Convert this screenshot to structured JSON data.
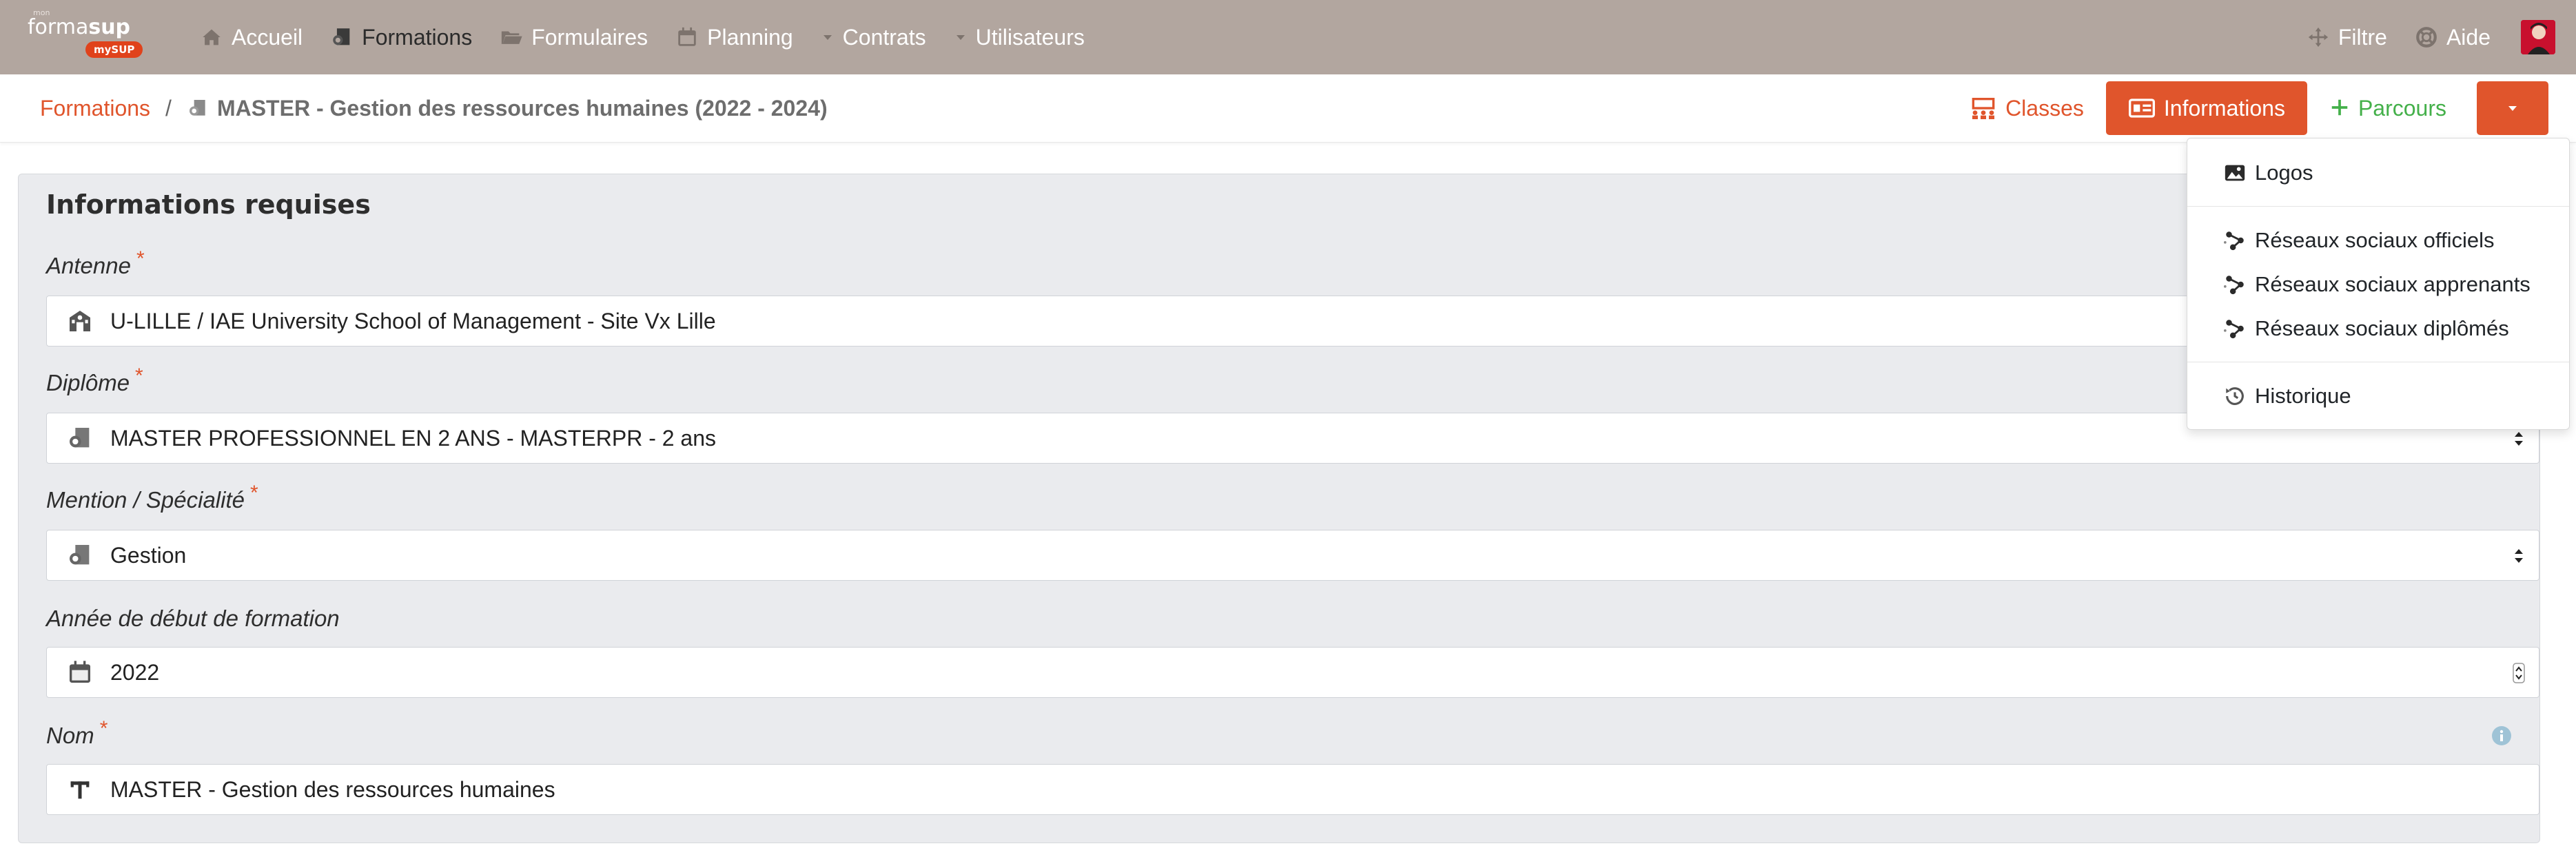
{
  "navbar": {
    "brand_tiny": "mon",
    "brand_name_1": "forma",
    "brand_name_2": "sup",
    "brand_sub": "mySUP",
    "items": [
      {
        "label": "Accueil",
        "icon": "home-icon"
      },
      {
        "label": "Formations",
        "icon": "formations-icon",
        "active": true
      },
      {
        "label": "Formulaires",
        "icon": "folder-open-icon"
      },
      {
        "label": "Planning",
        "icon": "calendar-icon"
      },
      {
        "label": "Contrats",
        "icon": "caret-down-icon"
      },
      {
        "label": "Utilisateurs",
        "icon": "caret-down-icon"
      }
    ],
    "right": [
      {
        "label": "Filtre",
        "icon": "move-icon"
      },
      {
        "label": "Aide",
        "icon": "life-ring-icon"
      }
    ]
  },
  "breadcrumb": {
    "root": "Formations",
    "separator": "/",
    "current": "MASTER - Gestion des ressources humaines (2022 - 2024)"
  },
  "actions": {
    "classes": "Classes",
    "informations": "Informations",
    "parcours": "Parcours"
  },
  "dropdown": {
    "items": [
      {
        "label": "Logos",
        "icon": "image-icon"
      },
      {
        "label": "Réseaux sociaux officiels",
        "icon": "network-icon"
      },
      {
        "label": "Réseaux sociaux apprenants",
        "icon": "network-icon"
      },
      {
        "label": "Réseaux sociaux diplômés",
        "icon": "network-icon"
      },
      {
        "label": "Historique",
        "icon": "history-icon"
      }
    ]
  },
  "form": {
    "title": "Informations requises",
    "fields": [
      {
        "label": "Antenne",
        "required": true,
        "value": "U-LILLE / IAE University School of Management - Site Vx Lille",
        "icon": "building-icon"
      },
      {
        "label": "Diplôme",
        "required": true,
        "value": "MASTER PROFESSIONNEL EN 2 ANS - MASTERPR - 2 ans",
        "icon": "diploma-icon"
      },
      {
        "label": "Mention / Spécialité",
        "required": true,
        "value": "Gestion",
        "icon": "diploma-icon"
      },
      {
        "label": "Année de début de formation",
        "required": false,
        "value": "2022",
        "icon": "calendar-icon"
      },
      {
        "label": "Nom",
        "required": true,
        "value": "MASTER - Gestion des ressources humaines",
        "icon": "text-icon"
      }
    ]
  },
  "colors": {
    "navbar": "#b2a69f",
    "accent": "#e0552c",
    "green": "#44b04a",
    "card_bg": "#eaebee"
  }
}
